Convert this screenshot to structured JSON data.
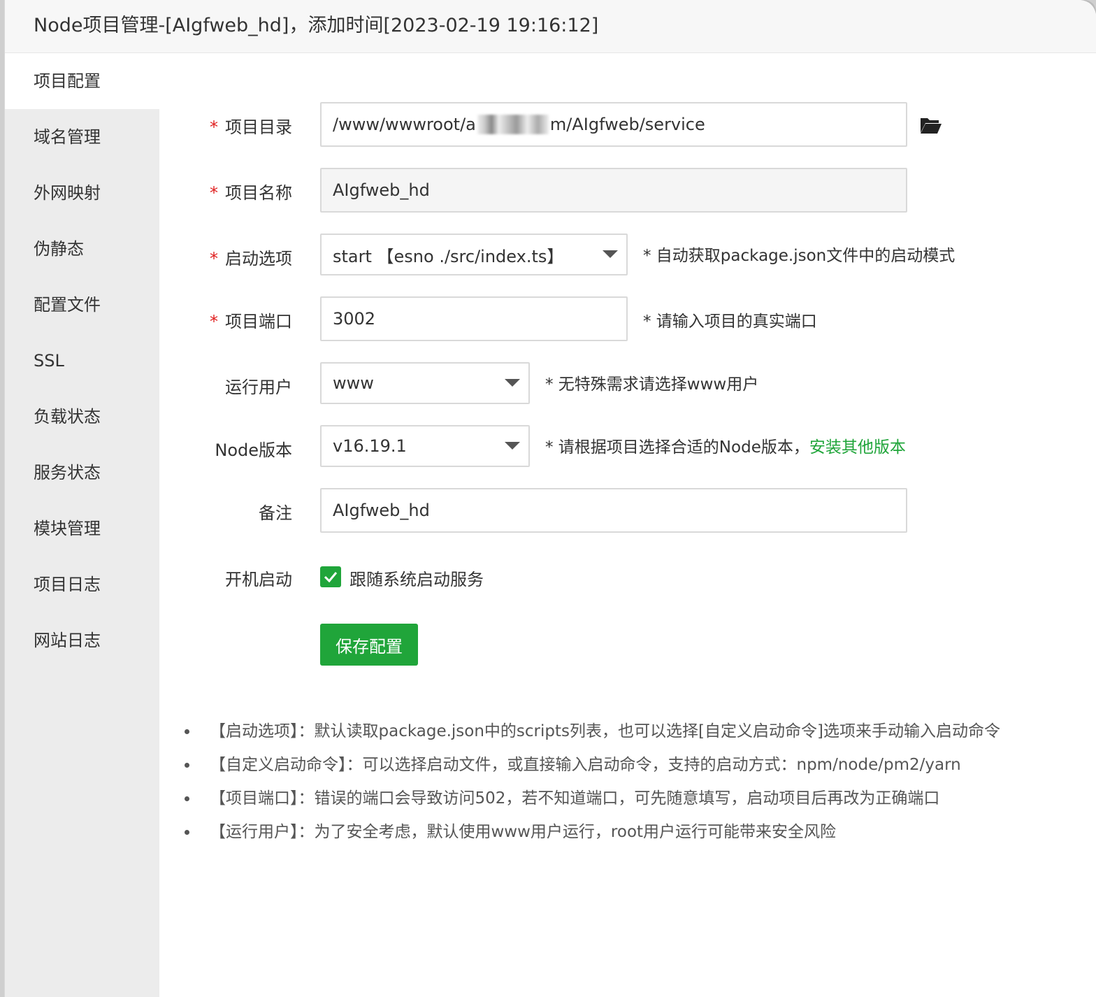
{
  "dialog": {
    "title": "Node项目管理-[AIgfweb_hd]，添加时间[2023-02-19 19:16:12]"
  },
  "sidebar": {
    "items": [
      {
        "label": "项目配置",
        "active": true
      },
      {
        "label": "域名管理"
      },
      {
        "label": "外网映射"
      },
      {
        "label": "伪静态"
      },
      {
        "label": "配置文件"
      },
      {
        "label": "SSL"
      },
      {
        "label": "负载状态"
      },
      {
        "label": "服务状态"
      },
      {
        "label": "模块管理"
      },
      {
        "label": "项目日志"
      },
      {
        "label": "网站日志"
      }
    ]
  },
  "form": {
    "required_mark": "*",
    "project_dir": {
      "label": "项目目录",
      "value_prefix": "/www/wwwroot/a",
      "value_suffix": "m/AIgfweb/service"
    },
    "project_name": {
      "label": "项目名称",
      "value": "AIgfweb_hd"
    },
    "start_option": {
      "label": "启动选项",
      "value": "start 【esno ./src/index.ts】",
      "hint": "* 自动获取package.json文件中的启动模式"
    },
    "project_port": {
      "label": "项目端口",
      "value": "3002",
      "hint": "* 请输入项目的真实端口"
    },
    "run_user": {
      "label": "运行用户",
      "value": "www",
      "hint": "* 无特殊需求请选择www用户"
    },
    "node_version": {
      "label": "Node版本",
      "value": "v16.19.1",
      "hint": "* 请根据项目选择合适的Node版本，",
      "link": "安装其他版本"
    },
    "remark": {
      "label": "备注",
      "value": "AIgfweb_hd"
    },
    "autostart": {
      "label": "开机启动",
      "checkbox_label": "跟随系统启动服务",
      "checked": true
    },
    "save_label": "保存配置"
  },
  "notes": [
    "【启动选项】：默认读取package.json中的scripts列表，也可以选择[自定义启动命令]选项来手动输入启动命令",
    "【自定义启动命令】：可以选择启动文件，或直接输入启动命令，支持的启动方式：npm/node/pm2/yarn",
    "【项目端口】：错误的端口会导致访问502，若不知道端口，可先随意填写，启动项目后再改为正确端口",
    "【运行用户】：为了安全考虑，默认使用www用户运行，root用户运行可能带来安全风险"
  ],
  "colors": {
    "accent": "#20a53a",
    "required": "#e02020"
  }
}
